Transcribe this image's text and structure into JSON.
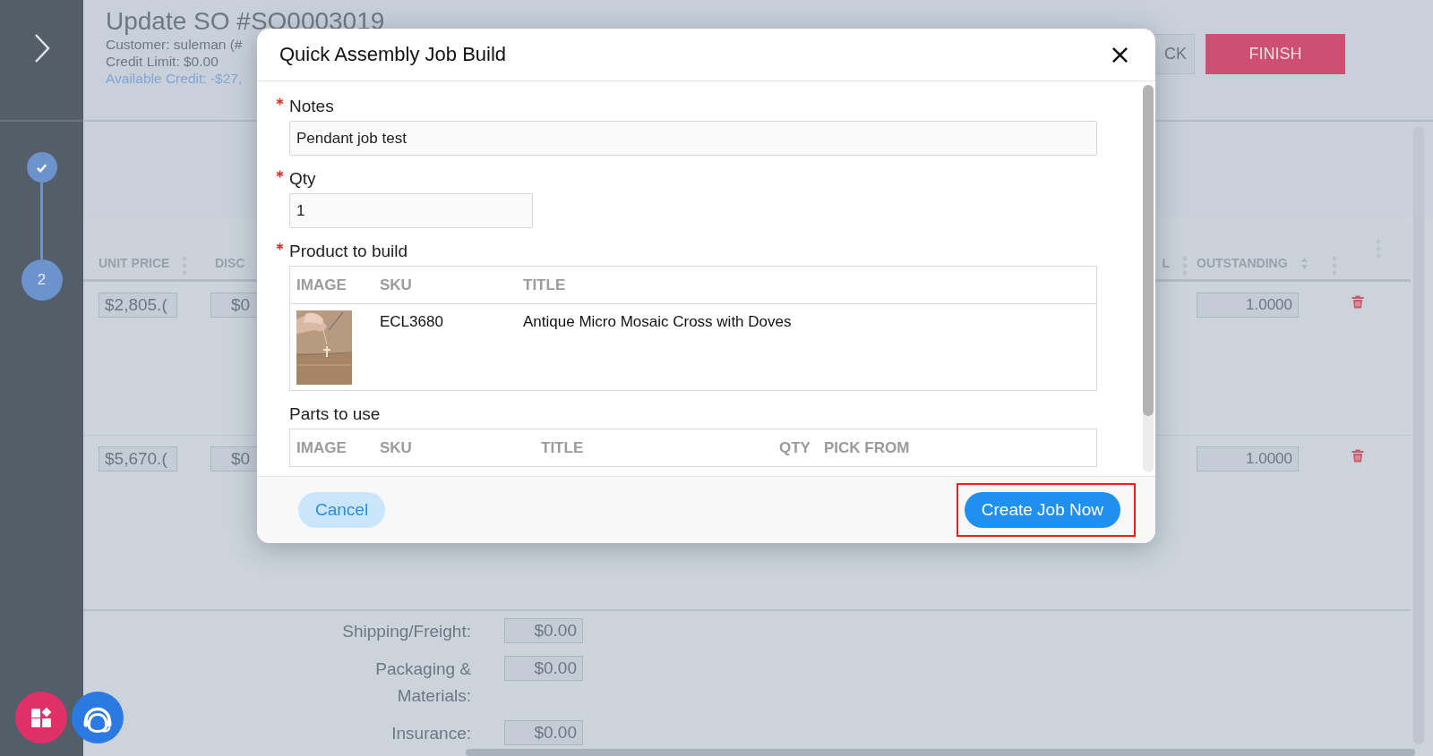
{
  "sidebar": {
    "steps": [
      {
        "completed": true
      },
      {
        "label": "2",
        "completed": false
      }
    ]
  },
  "order": {
    "title": "Update SO #SO0003019",
    "customer": "Customer: suleman (#",
    "credit_limit": "Credit Limit: $0.00",
    "available_credit": "Available Credit: -$27,"
  },
  "actions": [
    {
      "label": "CK",
      "kind": "secondary"
    },
    {
      "label": "FINISH",
      "kind": "primary"
    }
  ],
  "line_items": {
    "columns": [
      "UNIT PRICE",
      "DISC",
      "L",
      "OUTSTANDING"
    ],
    "rows": [
      {
        "unit_price": "$2,805.(",
        "discount": "$0",
        "outstanding": "1.0000"
      },
      {
        "unit_price": "$5,670.(",
        "discount": "$0",
        "outstanding": "1.0000"
      }
    ]
  },
  "totals": [
    {
      "label": "Shipping/Freight:",
      "value": "$0.00"
    },
    {
      "label": "Packaging & Materials:",
      "value": "$0.00"
    },
    {
      "label": "Insurance:",
      "value": "$0.00"
    }
  ],
  "dialog": {
    "title": "Quick Assembly Job Build",
    "fields": [
      {
        "label": "Notes",
        "required": true,
        "value": "Pendant job test",
        "kind": "wide"
      },
      {
        "label": "Qty",
        "required": true,
        "value": "1",
        "kind": "short"
      }
    ],
    "product": {
      "label": "Product to build",
      "required": true,
      "columns": [
        "IMAGE",
        "SKU",
        "TITLE"
      ],
      "rows": [
        {
          "sku": "ECL3680",
          "title": "Antique Micro Mosaic Cross with Doves"
        }
      ]
    },
    "parts": {
      "label": "Parts to use",
      "columns": [
        "IMAGE",
        "SKU",
        "TITLE",
        "QTY",
        "PICK FROM"
      ]
    },
    "buttons": [
      {
        "label": "Cancel",
        "kind": "secondary"
      },
      {
        "label": "Create Job Now",
        "kind": "primary",
        "highlighted": true
      }
    ]
  }
}
